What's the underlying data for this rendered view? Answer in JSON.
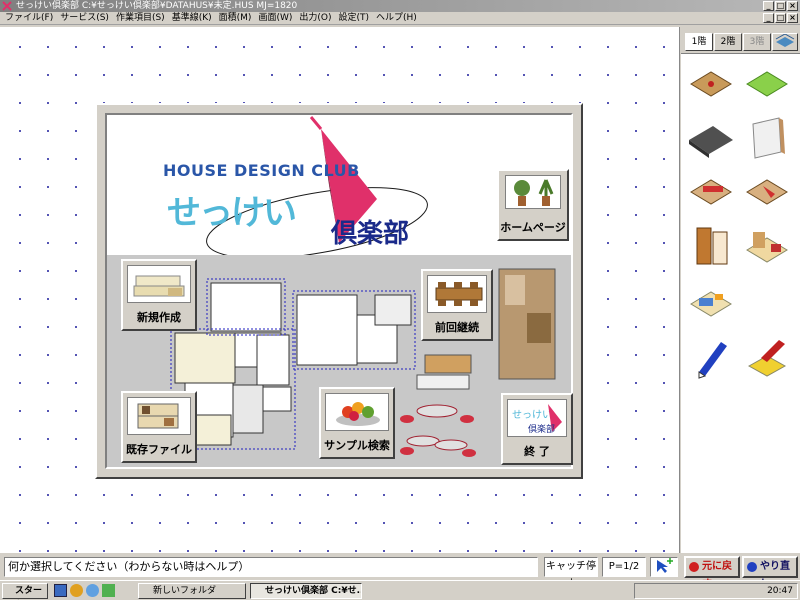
{
  "window": {
    "title": "せっけい倶楽部 C:¥せっけい倶楽部¥DATAHUS¥未定.HUS  MJ=1820",
    "controls": [
      "_",
      "□",
      "×"
    ]
  },
  "menu": [
    "ファイル(F)",
    "サービス(S)",
    "作業項目(S)",
    "基準線(K)",
    "面積(M)",
    "画面(W)",
    "出力(O)",
    "設定(T)",
    "ヘルプ(H)"
  ],
  "mdi_controls": [
    "_",
    "□",
    "×"
  ],
  "dialog": {
    "logo_top": "HOUSE DESIGN CLUB",
    "logo_main": "せっけい",
    "logo_kanji": "倶楽部",
    "buttons": {
      "homepage": "ホームページ",
      "new": "新規作成",
      "resume": "前回継続",
      "existing": "既存ファイル",
      "sample": "サンプル検索",
      "exit": "終 了"
    }
  },
  "floors": {
    "tabs": [
      "1階",
      "2階",
      "3階"
    ],
    "active": 0
  },
  "status": {
    "prompt": "何か選択してください（わからない時はヘルプ）",
    "snap": "キャッチ停止",
    "page": "P=1/2",
    "undo": "元に戻す",
    "redo": "やり直し"
  },
  "taskbar": {
    "start": "スタート",
    "tasks": [
      "新しいフォルダ",
      "せっけい倶楽部 C:¥せ..."
    ],
    "active_task": 1,
    "clock": "20:47"
  },
  "colors": {
    "accent_pink": "#e0306a",
    "logo_blue": "#2a56a8",
    "grid_dot": "#3a3aa8"
  }
}
